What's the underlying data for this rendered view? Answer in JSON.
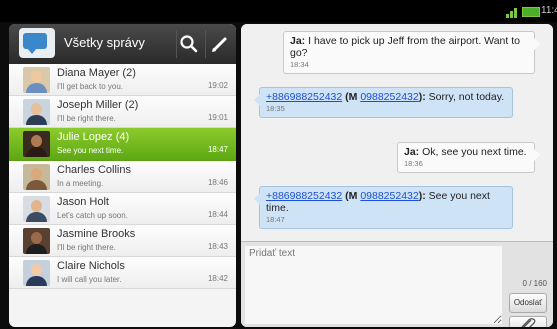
{
  "status_bar": {
    "time": "11:4",
    "accent": "#7ec540"
  },
  "left_panel": {
    "title": "Všetky správy",
    "icons": [
      "messages-app-icon",
      "search-icon",
      "compose-icon"
    ],
    "conversations": [
      {
        "name": "Diana Mayer (2)",
        "snippet": "I'll get back to you.",
        "time": "19:02",
        "selected": false
      },
      {
        "name": "Joseph Miller (2)",
        "snippet": "I'll be right there.",
        "time": "19:01",
        "selected": false
      },
      {
        "name": "Julie Lopez (4)",
        "snippet": "See you next time.",
        "time": "18:47",
        "selected": true
      },
      {
        "name": "Charles Collins",
        "snippet": "In a meeting.",
        "time": "18:46",
        "selected": false
      },
      {
        "name": "Jason Holt",
        "snippet": "Let's catch up soon.",
        "time": "18:44",
        "selected": false
      },
      {
        "name": "Jasmine Brooks",
        "snippet": "I'll be right there.",
        "time": "18:43",
        "selected": false
      },
      {
        "name": "Claire Nichols",
        "snippet": "I will call you later.",
        "time": "18:42",
        "selected": false
      }
    ],
    "selected_color": "#7cbd22"
  },
  "messages": [
    {
      "direction": "out",
      "sender": "Ja:",
      "text": "I have to pick up Jeff from the airport. Want to go?",
      "time": "18:34"
    },
    {
      "direction": "in",
      "number": "+886988252432",
      "sender_prefix": "(M ",
      "number2": "0988252432",
      "sender_suffix": "):",
      "text": "Sorry, not today.",
      "time": "18:35"
    },
    {
      "direction": "out",
      "sender": "Ja:",
      "text": "Ok, see you next time.",
      "time": "18:36"
    },
    {
      "direction": "in",
      "number": "+886988252432",
      "sender_prefix": "(M ",
      "number2": "0988252432",
      "sender_suffix": "):",
      "text": "See you next time.",
      "time": "18:47"
    }
  ],
  "compose": {
    "placeholder": "Pridať text",
    "counter": "0 / 160",
    "send_label": "Odoslať",
    "attach_icon": "paperclip-icon"
  }
}
